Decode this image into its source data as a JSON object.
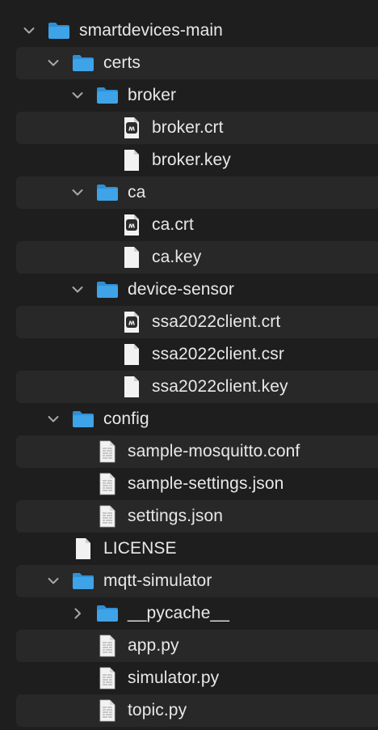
{
  "tree": {
    "rows": [
      {
        "label": "smartdevices-main",
        "type": "folder",
        "depth": 0,
        "expanded": true,
        "alt": false
      },
      {
        "label": "certs",
        "type": "folder",
        "depth": 1,
        "expanded": true,
        "alt": true
      },
      {
        "label": "broker",
        "type": "folder",
        "depth": 2,
        "expanded": true,
        "alt": false
      },
      {
        "label": "broker.crt",
        "type": "cert",
        "depth": 3,
        "expanded": null,
        "alt": true
      },
      {
        "label": "broker.key",
        "type": "blank",
        "depth": 3,
        "expanded": null,
        "alt": false
      },
      {
        "label": "ca",
        "type": "folder",
        "depth": 2,
        "expanded": true,
        "alt": true
      },
      {
        "label": "ca.crt",
        "type": "cert",
        "depth": 3,
        "expanded": null,
        "alt": false
      },
      {
        "label": "ca.key",
        "type": "blank",
        "depth": 3,
        "expanded": null,
        "alt": true
      },
      {
        "label": "device-sensor",
        "type": "folder",
        "depth": 2,
        "expanded": true,
        "alt": false
      },
      {
        "label": "ssa2022client.crt",
        "type": "cert",
        "depth": 3,
        "expanded": null,
        "alt": true
      },
      {
        "label": "ssa2022client.csr",
        "type": "blank",
        "depth": 3,
        "expanded": null,
        "alt": false
      },
      {
        "label": "ssa2022client.key",
        "type": "blank",
        "depth": 3,
        "expanded": null,
        "alt": true
      },
      {
        "label": "config",
        "type": "folder",
        "depth": 1,
        "expanded": true,
        "alt": false
      },
      {
        "label": "sample-mosquitto.conf",
        "type": "text",
        "depth": 2,
        "expanded": null,
        "alt": true
      },
      {
        "label": "sample-settings.json",
        "type": "text",
        "depth": 2,
        "expanded": null,
        "alt": false
      },
      {
        "label": "settings.json",
        "type": "text",
        "depth": 2,
        "expanded": null,
        "alt": true
      },
      {
        "label": "LICENSE",
        "type": "blank",
        "depth": 1,
        "expanded": null,
        "alt": false
      },
      {
        "label": "mqtt-simulator",
        "type": "folder",
        "depth": 1,
        "expanded": true,
        "alt": true
      },
      {
        "label": "__pycache__",
        "type": "folder",
        "depth": 2,
        "expanded": false,
        "alt": false
      },
      {
        "label": "app.py",
        "type": "text",
        "depth": 2,
        "expanded": null,
        "alt": true
      },
      {
        "label": "simulator.py",
        "type": "text",
        "depth": 2,
        "expanded": null,
        "alt": false
      },
      {
        "label": "topic.py",
        "type": "text",
        "depth": 2,
        "expanded": null,
        "alt": true
      }
    ]
  },
  "colors": {
    "folder_body": "#3fa3e8",
    "folder_tab": "#2f8fd6",
    "chevron": "#a8a8a8",
    "page": "#f2f2f2"
  }
}
